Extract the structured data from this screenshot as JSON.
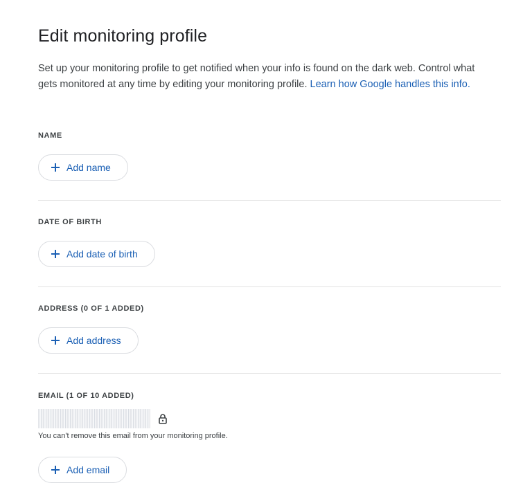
{
  "page": {
    "title": "Edit monitoring profile",
    "intro_text": "Set up your monitoring profile to get notified when your info is found on the dark web. Control what gets monitored at any time by editing your monitoring profile. ",
    "intro_link": "Learn how Google handles this info."
  },
  "sections": {
    "name": {
      "label": "NAME",
      "button": "Add name"
    },
    "dob": {
      "label": "DATE OF BIRTH",
      "button": "Add date of birth"
    },
    "address": {
      "label": "ADDRESS (0 OF 1 ADDED)",
      "button": "Add address"
    },
    "email": {
      "label": "EMAIL (1 OF 10 ADDED)",
      "note": "You can't remove this email from your monitoring profile.",
      "button": "Add email",
      "lock_icon": "lock-icon"
    }
  },
  "colors": {
    "link": "#1a5fb4",
    "text": "#202124",
    "divider": "#e3e3e3"
  }
}
